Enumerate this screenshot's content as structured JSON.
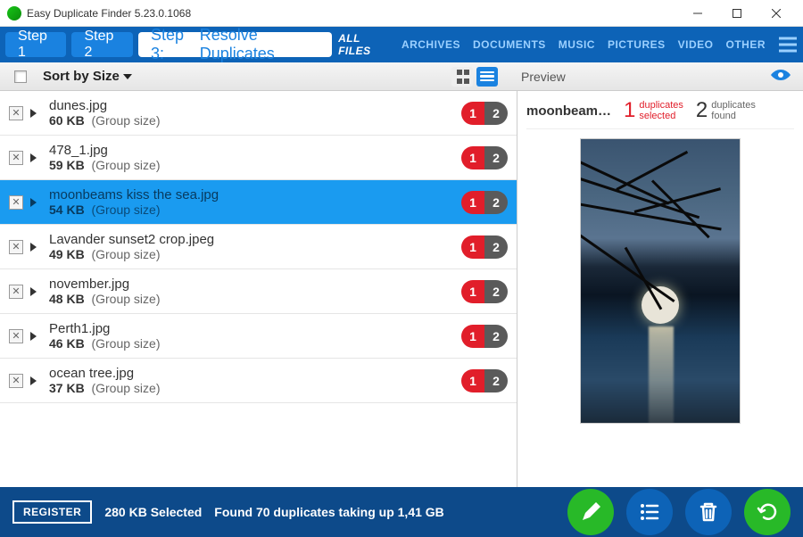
{
  "window": {
    "title": "Easy Duplicate Finder 5.23.0.1068"
  },
  "steps": {
    "s1": "Step 1",
    "s2": "Step 2",
    "s3": "Step 3:",
    "s3d": "Resolve Duplicates"
  },
  "filters": [
    "ALL FILES",
    "ARCHIVES",
    "DOCUMENTS",
    "MUSIC",
    "PICTURES",
    "VIDEO",
    "OTHER"
  ],
  "toolbar": {
    "sort_label": "Sort by Size",
    "preview_label": "Preview"
  },
  "rows": [
    {
      "name": "dunes.jpg",
      "size": "60 KB",
      "group": "(Group size)",
      "p1": "1",
      "p2": "2",
      "sel": false
    },
    {
      "name": "478_1.jpg",
      "size": "59 KB",
      "group": "(Group size)",
      "p1": "1",
      "p2": "2",
      "sel": false
    },
    {
      "name": "moonbeams kiss the sea.jpg",
      "size": "54 KB",
      "group": "(Group size)",
      "p1": "1",
      "p2": "2",
      "sel": true
    },
    {
      "name": "Lavander sunset2 crop.jpeg",
      "size": "49 KB",
      "group": "(Group size)",
      "p1": "1",
      "p2": "2",
      "sel": false
    },
    {
      "name": "november.jpg",
      "size": "48 KB",
      "group": "(Group size)",
      "p1": "1",
      "p2": "2",
      "sel": false
    },
    {
      "name": "Perth1.jpg",
      "size": "46 KB",
      "group": "(Group size)",
      "p1": "1",
      "p2": "2",
      "sel": false
    },
    {
      "name": "ocean tree.jpg",
      "size": "37 KB",
      "group": "(Group size)",
      "p1": "1",
      "p2": "2",
      "sel": false
    }
  ],
  "preview": {
    "filename": "moonbeam…",
    "dup_sel_n": "1",
    "dup_sel_l1": "duplicates",
    "dup_sel_l2": "selected",
    "dup_f_n": "2",
    "dup_f_l1": "duplicates",
    "dup_f_l2": "found"
  },
  "footer": {
    "register": "REGISTER",
    "selected": "280 KB Selected",
    "found": "Found 70 duplicates taking up 1,41 GB"
  }
}
